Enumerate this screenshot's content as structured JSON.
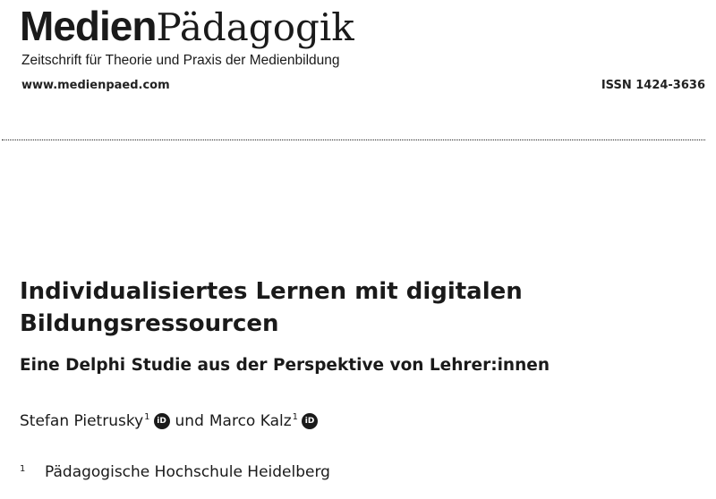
{
  "journal": {
    "logo_bold": "Medien",
    "logo_serif": "Pädagogik",
    "tagline": "Zeitschrift für Theorie und Praxis der Medienbildung",
    "url": "www.medienpaed.com",
    "issn": "ISSN 1424-3636"
  },
  "article": {
    "title": "Individualisiertes Lernen mit digitalen Bildungsressourcen",
    "subtitle": "Eine Delphi Studie aus der Perspektive von Lehrer:innen",
    "authors": [
      {
        "name": "Stefan Pietrusky",
        "affil": "1",
        "icon": "orcid-icon"
      },
      {
        "name": "Marco Kalz",
        "affil": "1",
        "icon": "orcid-icon"
      }
    ],
    "connector": "und",
    "orcid_glyph": "iD",
    "affiliations": [
      {
        "num": "1",
        "name": "Pädagogische Hochschule Heidelberg"
      }
    ]
  }
}
